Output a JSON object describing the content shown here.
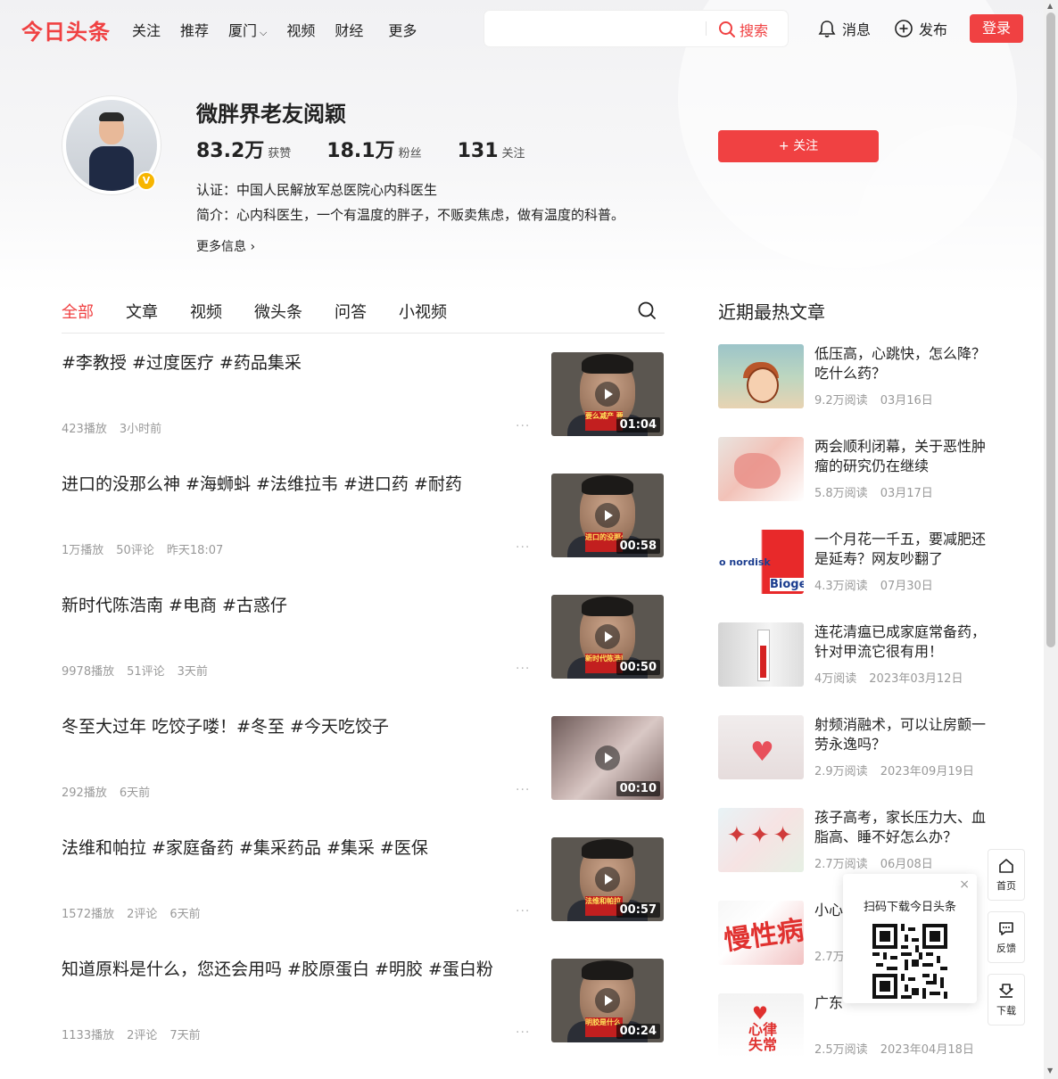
{
  "header": {
    "logo": "今日头条",
    "nav": [
      "关注",
      "推荐",
      "厦门",
      "视频",
      "财经",
      "更多"
    ],
    "nav_city_has_dropdown": true,
    "search_button": "搜索",
    "search_placeholder": "",
    "messages": "消息",
    "publish": "发布",
    "login": "登录",
    "accent_color": "#f04142"
  },
  "profile": {
    "name": "微胖界老友阅颖",
    "likes_num": "83.2万",
    "likes_label": "获赞",
    "fans_num": "18.1万",
    "fans_label": "粉丝",
    "follow_num": "131",
    "follow_label": "关注",
    "cert": "认证：中国人民解放军总医院心内科医生",
    "intro": "简介：心内科医生，一个有温度的胖子，不贩卖焦虑，做有温度的科普。",
    "more_info": "更多信息 ›",
    "follow_button": "+ 关注"
  },
  "tabs": [
    "全部",
    "文章",
    "视频",
    "微头条",
    "问答",
    "小视频"
  ],
  "active_tab": "全部",
  "feed": [
    {
      "title": "#李教授 #过度医疗 #药品集采",
      "meta": [
        "423播放",
        "3小时前"
      ],
      "duration": "01:04",
      "caption": "要么减产 要么自主"
    },
    {
      "title": "进口的没那么神 #海蛳蚪 #法维拉韦 #进口药 #耐药",
      "meta": [
        "1万播放",
        "50评论",
        "昨天18:07"
      ],
      "duration": "00:58",
      "caption": "进口的没那么"
    },
    {
      "title": "新时代陈浩南 #电商 #古惑仔",
      "meta": [
        "9978播放",
        "51评论",
        "3天前"
      ],
      "duration": "00:50",
      "caption": "新时代陈浩南"
    },
    {
      "title": "冬至大过年 吃饺子喽！#冬至 #今天吃饺子",
      "meta": [
        "292播放",
        "6天前"
      ],
      "duration": "00:10",
      "caption": ""
    },
    {
      "title": "法维和帕拉 #家庭备药 #集采药品 #集采 #医保",
      "meta": [
        "1572播放",
        "2评论",
        "6天前"
      ],
      "duration": "00:57",
      "caption": "法维和帕拉"
    },
    {
      "title": "知道原料是什么，您还会用吗 #胶原蛋白 #明胶 #蛋白粉",
      "meta": [
        "1133播放",
        "2评论",
        "7天前"
      ],
      "duration": "00:24",
      "caption": "明胶是什么"
    }
  ],
  "sidebar": {
    "title": "近期最热文章",
    "items": [
      {
        "title": "低压高，心跳快，怎么降？吃什么药？",
        "reads": "9.2万阅读",
        "date": "03月16日"
      },
      {
        "title": "两会顺利闭幕，关于恶性肿瘤的研究仍在继续",
        "reads": "5.8万阅读",
        "date": "03月17日"
      },
      {
        "title": "一个月花一千五，要减肥还是延寿？网友吵翻了",
        "reads": "4.3万阅读",
        "date": "07月30日"
      },
      {
        "title": "连花清瘟已成家庭常备药，针对甲流它很有用！",
        "reads": "4万阅读",
        "date": "2023年03月12日"
      },
      {
        "title": "射频消融术，可以让房颤一劳永逸吗？",
        "reads": "2.9万阅读",
        "date": "2023年09月19日"
      },
      {
        "title": "孩子高考，家长压力大、血脂高、睡不好怎么办？",
        "reads": "2.7万阅读",
        "date": "06月08日"
      },
      {
        "title": "小心慢性病，你的",
        "reads": "2.7万",
        "date": ""
      },
      {
        "title": "广东",
        "reads": "2.5万阅读",
        "date": "2023年04月18日"
      }
    ],
    "thumb_texts": {
      "novo": "o nordisk",
      "biogen": "Bioge",
      "chronic": "慢性病",
      "arrhythmia_1": "心律",
      "arrhythmia_2": "失常"
    }
  },
  "qr_popup": {
    "label": "扫码下载今日头条",
    "close": "×"
  },
  "float_buttons": [
    "首页",
    "反馈",
    "下载"
  ]
}
